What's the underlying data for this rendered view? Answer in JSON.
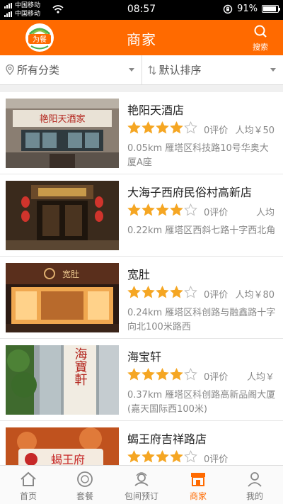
{
  "status_bar": {
    "carrier1": "中国移动",
    "carrier2": "中国移动",
    "time": "08:57",
    "battery": "91%",
    "battery_level": 0.91
  },
  "header": {
    "title": "商家",
    "logo_text": "为餐",
    "search_label": "搜索"
  },
  "filters": {
    "category": "所有分类",
    "sort": "默认排序"
  },
  "merchants": [
    {
      "name": "艳阳天酒店",
      "rating": 4,
      "reviews": "0评价",
      "avg_price": "人均￥50",
      "address": "0.05km 雁塔区科技路10号华奥大厦A座"
    },
    {
      "name": "大海子西府民俗村高新店",
      "rating": 4,
      "reviews": "0评价",
      "avg_price": "人均",
      "address": "0.22km 雁塔区西斜七路十字西北角"
    },
    {
      "name": "宽肚",
      "rating": 4,
      "reviews": "0评价",
      "avg_price": "人均￥80",
      "address": "0.24km 雁塔区科创路与融鑫路十字向北100米路西"
    },
    {
      "name": "海宝轩",
      "rating": 4,
      "reviews": "0评价",
      "avg_price": "人均￥",
      "address": "0.37km 雁塔区科创路高新品阁大厦(嘉天国际西100米)"
    },
    {
      "name": "蝎王府吉祥路店",
      "rating": 4,
      "reviews": "0评价",
      "avg_price": "",
      "address": ""
    }
  ],
  "photo_signs": {
    "sign1": "艳阳天酒家",
    "sign3": "宽肚",
    "sign4": "海寶軒",
    "sign5": "蝎王府"
  },
  "tabs": [
    {
      "label": "首页",
      "icon": "home-icon",
      "active": false
    },
    {
      "label": "套餐",
      "icon": "package-icon",
      "active": false
    },
    {
      "label": "包间预订",
      "icon": "booking-icon",
      "active": false
    },
    {
      "label": "商家",
      "icon": "store-icon",
      "active": true
    },
    {
      "label": "我的",
      "icon": "user-icon",
      "active": false
    }
  ],
  "colors": {
    "brand": "#ff6a00",
    "star": "#f5a623"
  }
}
